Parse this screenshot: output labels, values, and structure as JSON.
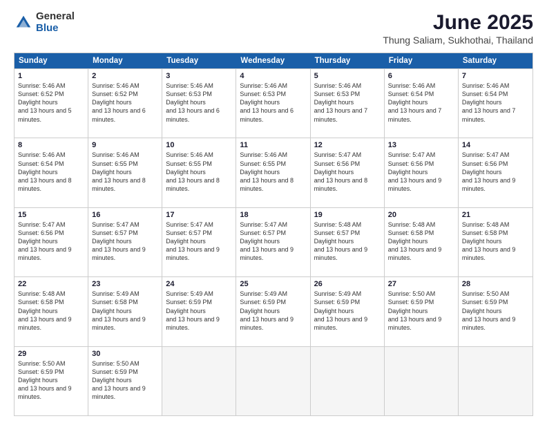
{
  "logo": {
    "general": "General",
    "blue": "Blue"
  },
  "title": "June 2025",
  "subtitle": "Thung Saliam, Sukhothai, Thailand",
  "headers": [
    "Sunday",
    "Monday",
    "Tuesday",
    "Wednesday",
    "Thursday",
    "Friday",
    "Saturday"
  ],
  "weeks": [
    [
      {
        "day": "1",
        "sunrise": "5:46 AM",
        "sunset": "6:52 PM",
        "daylight": "13 hours and 5 minutes."
      },
      {
        "day": "2",
        "sunrise": "5:46 AM",
        "sunset": "6:52 PM",
        "daylight": "13 hours and 6 minutes."
      },
      {
        "day": "3",
        "sunrise": "5:46 AM",
        "sunset": "6:53 PM",
        "daylight": "13 hours and 6 minutes."
      },
      {
        "day": "4",
        "sunrise": "5:46 AM",
        "sunset": "6:53 PM",
        "daylight": "13 hours and 6 minutes."
      },
      {
        "day": "5",
        "sunrise": "5:46 AM",
        "sunset": "6:53 PM",
        "daylight": "13 hours and 7 minutes."
      },
      {
        "day": "6",
        "sunrise": "5:46 AM",
        "sunset": "6:54 PM",
        "daylight": "13 hours and 7 minutes."
      },
      {
        "day": "7",
        "sunrise": "5:46 AM",
        "sunset": "6:54 PM",
        "daylight": "13 hours and 7 minutes."
      }
    ],
    [
      {
        "day": "8",
        "sunrise": "5:46 AM",
        "sunset": "6:54 PM",
        "daylight": "13 hours and 8 minutes."
      },
      {
        "day": "9",
        "sunrise": "5:46 AM",
        "sunset": "6:55 PM",
        "daylight": "13 hours and 8 minutes."
      },
      {
        "day": "10",
        "sunrise": "5:46 AM",
        "sunset": "6:55 PM",
        "daylight": "13 hours and 8 minutes."
      },
      {
        "day": "11",
        "sunrise": "5:46 AM",
        "sunset": "6:55 PM",
        "daylight": "13 hours and 8 minutes."
      },
      {
        "day": "12",
        "sunrise": "5:47 AM",
        "sunset": "6:56 PM",
        "daylight": "13 hours and 8 minutes."
      },
      {
        "day": "13",
        "sunrise": "5:47 AM",
        "sunset": "6:56 PM",
        "daylight": "13 hours and 9 minutes."
      },
      {
        "day": "14",
        "sunrise": "5:47 AM",
        "sunset": "6:56 PM",
        "daylight": "13 hours and 9 minutes."
      }
    ],
    [
      {
        "day": "15",
        "sunrise": "5:47 AM",
        "sunset": "6:56 PM",
        "daylight": "13 hours and 9 minutes."
      },
      {
        "day": "16",
        "sunrise": "5:47 AM",
        "sunset": "6:57 PM",
        "daylight": "13 hours and 9 minutes."
      },
      {
        "day": "17",
        "sunrise": "5:47 AM",
        "sunset": "6:57 PM",
        "daylight": "13 hours and 9 minutes."
      },
      {
        "day": "18",
        "sunrise": "5:47 AM",
        "sunset": "6:57 PM",
        "daylight": "13 hours and 9 minutes."
      },
      {
        "day": "19",
        "sunrise": "5:48 AM",
        "sunset": "6:57 PM",
        "daylight": "13 hours and 9 minutes."
      },
      {
        "day": "20",
        "sunrise": "5:48 AM",
        "sunset": "6:58 PM",
        "daylight": "13 hours and 9 minutes."
      },
      {
        "day": "21",
        "sunrise": "5:48 AM",
        "sunset": "6:58 PM",
        "daylight": "13 hours and 9 minutes."
      }
    ],
    [
      {
        "day": "22",
        "sunrise": "5:48 AM",
        "sunset": "6:58 PM",
        "daylight": "13 hours and 9 minutes."
      },
      {
        "day": "23",
        "sunrise": "5:49 AM",
        "sunset": "6:58 PM",
        "daylight": "13 hours and 9 minutes."
      },
      {
        "day": "24",
        "sunrise": "5:49 AM",
        "sunset": "6:59 PM",
        "daylight": "13 hours and 9 minutes."
      },
      {
        "day": "25",
        "sunrise": "5:49 AM",
        "sunset": "6:59 PM",
        "daylight": "13 hours and 9 minutes."
      },
      {
        "day": "26",
        "sunrise": "5:49 AM",
        "sunset": "6:59 PM",
        "daylight": "13 hours and 9 minutes."
      },
      {
        "day": "27",
        "sunrise": "5:50 AM",
        "sunset": "6:59 PM",
        "daylight": "13 hours and 9 minutes."
      },
      {
        "day": "28",
        "sunrise": "5:50 AM",
        "sunset": "6:59 PM",
        "daylight": "13 hours and 9 minutes."
      }
    ],
    [
      {
        "day": "29",
        "sunrise": "5:50 AM",
        "sunset": "6:59 PM",
        "daylight": "13 hours and 9 minutes."
      },
      {
        "day": "30",
        "sunrise": "5:50 AM",
        "sunset": "6:59 PM",
        "daylight": "13 hours and 9 minutes."
      },
      null,
      null,
      null,
      null,
      null
    ]
  ]
}
